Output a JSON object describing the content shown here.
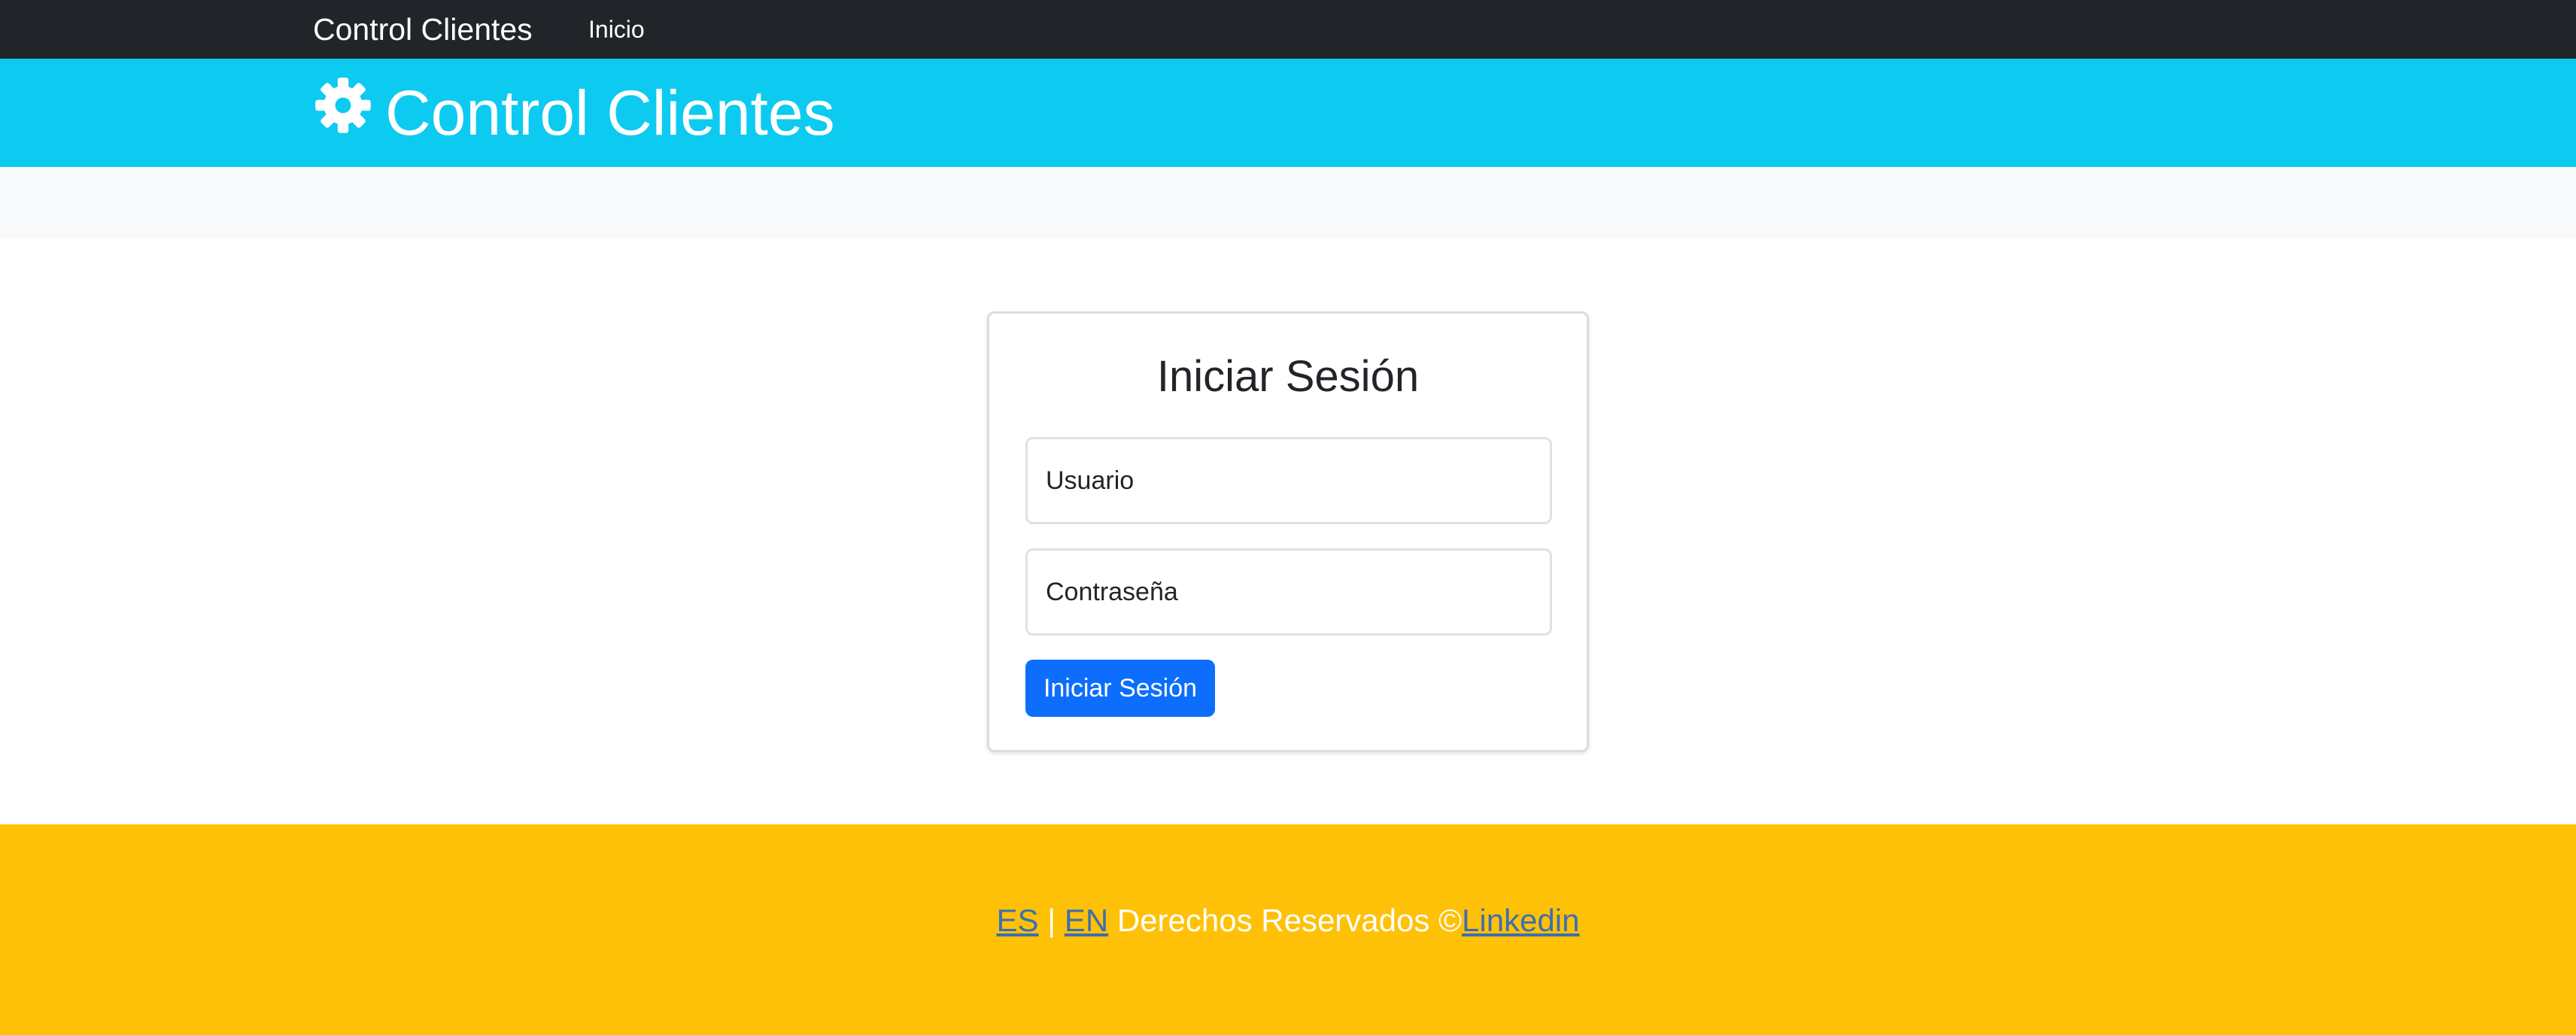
{
  "navbar": {
    "brand": "Control Clientes",
    "links": [
      {
        "label": "Inicio"
      }
    ]
  },
  "header": {
    "icon": "gear-icon",
    "title": "Control Clientes",
    "background": "#0dcaf0"
  },
  "login": {
    "title": "Iniciar Sesión",
    "username": {
      "value": "",
      "placeholder": "Usuario"
    },
    "password": {
      "value": "",
      "placeholder": "Contraseña"
    },
    "submit_label": "Iniciar Sesión",
    "button_color": "#0d6efd"
  },
  "footer": {
    "lang_es": "ES",
    "separator": "|",
    "lang_en": "EN",
    "rights_text": "Derechos Reservados ©",
    "linkedin_label": "Linkedin",
    "background": "#ffc107"
  }
}
